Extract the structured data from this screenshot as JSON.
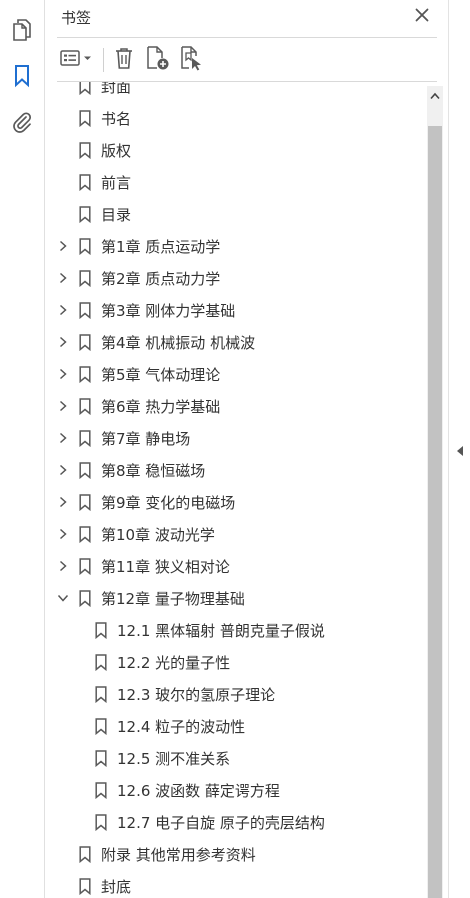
{
  "panel": {
    "title": "书签"
  },
  "rail": {
    "items": [
      {
        "name": "page-thumbnails-icon"
      },
      {
        "name": "bookmark-icon",
        "active": true
      },
      {
        "name": "attachment-icon"
      }
    ]
  },
  "toolbar": {
    "buttons": [
      {
        "name": "options-menu-icon"
      },
      {
        "name": "delete-bookmark-icon"
      },
      {
        "name": "new-bookmark-icon"
      },
      {
        "name": "new-bookmark-from-structure-icon"
      }
    ]
  },
  "colors": {
    "accent": "#1f6fd1",
    "icon": "#5a5a5a",
    "text": "#333333",
    "scroll_thumb": "#c2c2c2"
  },
  "bookmarks": [
    {
      "label": "封面",
      "level": 0,
      "expander": "none"
    },
    {
      "label": "书名",
      "level": 0,
      "expander": "none"
    },
    {
      "label": "版权",
      "level": 0,
      "expander": "none"
    },
    {
      "label": "前言",
      "level": 0,
      "expander": "none"
    },
    {
      "label": "目录",
      "level": 0,
      "expander": "none"
    },
    {
      "label": "第1章  质点运动学",
      "level": 0,
      "expander": "collapsed"
    },
    {
      "label": "第2章  质点动力学",
      "level": 0,
      "expander": "collapsed"
    },
    {
      "label": "第3章  刚体力学基础",
      "level": 0,
      "expander": "collapsed"
    },
    {
      "label": "第4章  机械振动  机械波",
      "level": 0,
      "expander": "collapsed"
    },
    {
      "label": "第5章  气体动理论",
      "level": 0,
      "expander": "collapsed"
    },
    {
      "label": "第6章  热力学基础",
      "level": 0,
      "expander": "collapsed"
    },
    {
      "label": "第7章  静电场",
      "level": 0,
      "expander": "collapsed"
    },
    {
      "label": "第8章  稳恒磁场",
      "level": 0,
      "expander": "collapsed"
    },
    {
      "label": "第9章  变化的电磁场",
      "level": 0,
      "expander": "collapsed"
    },
    {
      "label": "第10章  波动光学",
      "level": 0,
      "expander": "collapsed"
    },
    {
      "label": "第11章  狭义相对论",
      "level": 0,
      "expander": "collapsed"
    },
    {
      "label": "第12章  量子物理基础",
      "level": 0,
      "expander": "expanded"
    },
    {
      "label": "12.1  黑体辐射  普朗克量子假说",
      "level": 1,
      "expander": "none"
    },
    {
      "label": "12.2  光的量子性",
      "level": 1,
      "expander": "none"
    },
    {
      "label": "12.3  玻尔的氢原子理论",
      "level": 1,
      "expander": "none"
    },
    {
      "label": "12.4  粒子的波动性",
      "level": 1,
      "expander": "none"
    },
    {
      "label": "12.5  测不准关系",
      "level": 1,
      "expander": "none"
    },
    {
      "label": "12.6  波函数  薛定谔方程",
      "level": 1,
      "expander": "none"
    },
    {
      "label": "12.7  电子自旋  原子的壳层结构",
      "level": 1,
      "expander": "none"
    },
    {
      "label": "附录  其他常用参考资料",
      "level": 0,
      "expander": "none"
    },
    {
      "label": "封底",
      "level": 0,
      "expander": "none"
    }
  ]
}
